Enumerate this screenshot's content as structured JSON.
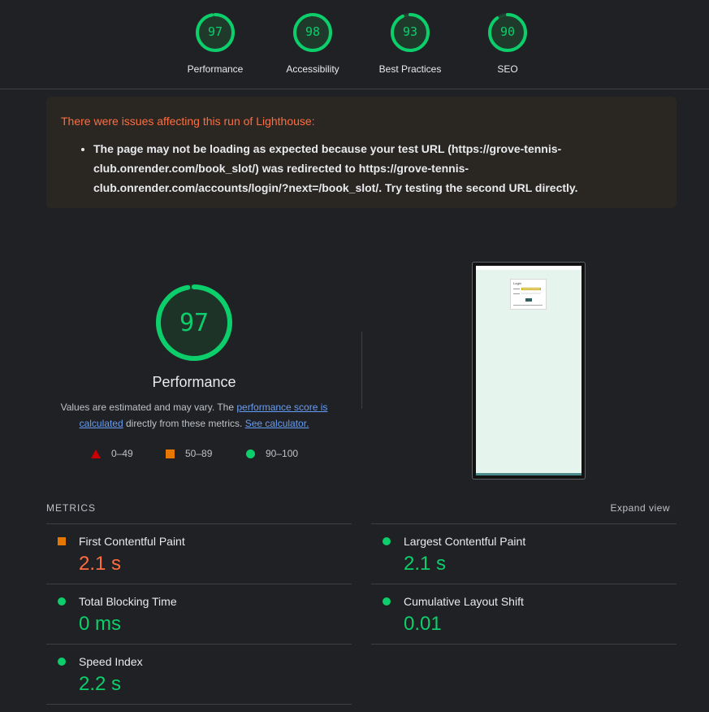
{
  "colors": {
    "pass": "#0cce6b",
    "average": "#e67700",
    "fail": "#cc0000",
    "warning_text": "#ff6d40",
    "link": "#669df6"
  },
  "gauges": [
    {
      "score": "97",
      "label": "Performance",
      "fraction": 0.97
    },
    {
      "score": "98",
      "label": "Accessibility",
      "fraction": 0.98
    },
    {
      "score": "93",
      "label": "Best Practices",
      "fraction": 0.93
    },
    {
      "score": "90",
      "label": "SEO",
      "fraction": 0.9
    }
  ],
  "warning": {
    "title": "There were issues affecting this run of Lighthouse:",
    "items": [
      "The page may not be loading as expected because your test URL (https://grove-tennis-club.onrender.com/book_slot/) was redirected to https://grove-tennis-club.onrender.com/accounts/login/?next=/book_slot/. Try testing the second URL directly."
    ]
  },
  "performance": {
    "score": "97",
    "fraction": 0.97,
    "title": "Performance",
    "desc_prefix": "Values are estimated and may vary. The ",
    "desc_link1": "performance score is calculated",
    "desc_middle": " directly from these metrics. ",
    "desc_link2": "See calculator.",
    "legend": [
      {
        "icon": "triangle-icon",
        "label": "0–49"
      },
      {
        "icon": "square-icon",
        "label": "50–89"
      },
      {
        "icon": "circle-icon",
        "label": "90–100"
      }
    ]
  },
  "screenshot": {
    "login_title": "Login"
  },
  "metrics": {
    "header": "METRICS",
    "expand_label": "Expand view",
    "items": [
      {
        "name": "First Contentful Paint",
        "value": "2.1 s",
        "status": "average"
      },
      {
        "name": "Largest Contentful Paint",
        "value": "2.1 s",
        "status": "pass"
      },
      {
        "name": "Total Blocking Time",
        "value": "0 ms",
        "status": "pass"
      },
      {
        "name": "Cumulative Layout Shift",
        "value": "0.01",
        "status": "pass"
      },
      {
        "name": "Speed Index",
        "value": "2.2 s",
        "status": "pass"
      }
    ]
  }
}
